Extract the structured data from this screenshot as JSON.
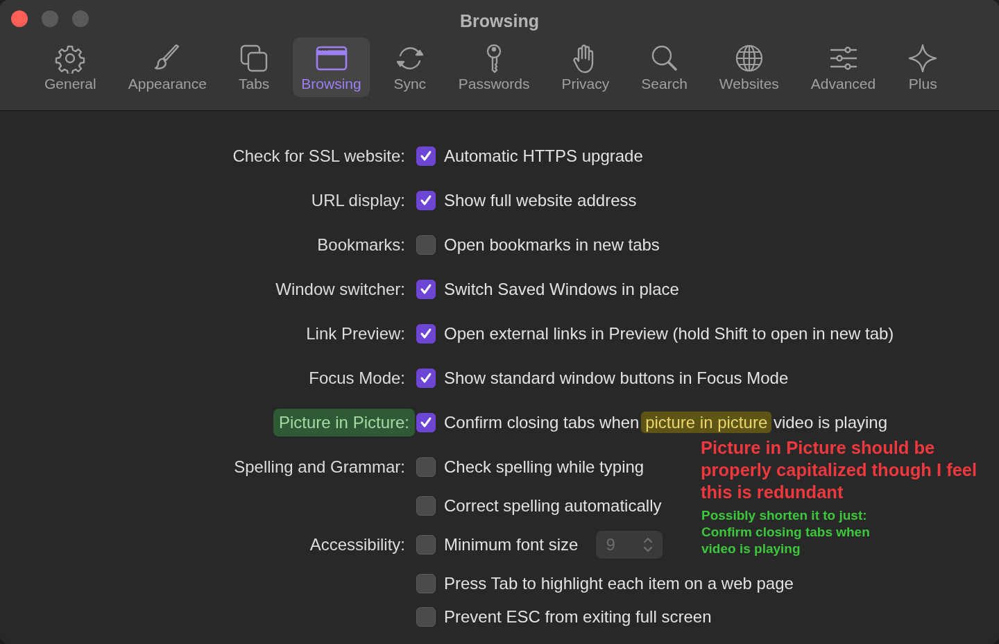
{
  "window": {
    "title": "Browsing"
  },
  "tabs": [
    {
      "label": "General",
      "selected": false
    },
    {
      "label": "Appearance",
      "selected": false
    },
    {
      "label": "Tabs",
      "selected": false
    },
    {
      "label": "Browsing",
      "selected": true
    },
    {
      "label": "Sync",
      "selected": false
    },
    {
      "label": "Passwords",
      "selected": false
    },
    {
      "label": "Privacy",
      "selected": false
    },
    {
      "label": "Search",
      "selected": false
    },
    {
      "label": "Websites",
      "selected": false
    },
    {
      "label": "Advanced",
      "selected": false
    },
    {
      "label": "Plus",
      "selected": false
    }
  ],
  "settings": [
    {
      "label": "Check for SSL website:",
      "options": [
        {
          "parts": [
            {
              "text": "Automatic HTTPS upgrade"
            }
          ],
          "checked": true
        }
      ]
    },
    {
      "label": "URL display:",
      "options": [
        {
          "parts": [
            {
              "text": "Show full website address"
            }
          ],
          "checked": true
        }
      ]
    },
    {
      "label": "Bookmarks:",
      "options": [
        {
          "parts": [
            {
              "text": "Open bookmarks in new tabs"
            }
          ],
          "checked": false
        }
      ]
    },
    {
      "label": "Window switcher:",
      "options": [
        {
          "parts": [
            {
              "text": "Switch Saved Windows in place"
            }
          ],
          "checked": true
        }
      ]
    },
    {
      "label": "Link Preview:",
      "options": [
        {
          "parts": [
            {
              "text": "Open external links in Preview (hold Shift to open in new tab)"
            }
          ],
          "checked": true
        }
      ]
    },
    {
      "label": "Focus Mode:",
      "options": [
        {
          "parts": [
            {
              "text": "Show standard window buttons in Focus Mode"
            }
          ],
          "checked": true
        }
      ]
    },
    {
      "label": "Picture in Picture:",
      "label_highlighted": true,
      "options": [
        {
          "parts": [
            {
              "text": "Confirm closing tabs when"
            },
            {
              "text": "picture in picture",
              "highlighted": true
            },
            {
              "text": "video is playing"
            }
          ],
          "checked": true
        }
      ]
    },
    {
      "label": "Spelling and Grammar:",
      "options": [
        {
          "parts": [
            {
              "text": "Check spelling while typing"
            }
          ],
          "checked": false
        },
        {
          "parts": [
            {
              "text": "Correct spelling automatically"
            }
          ],
          "checked": false
        }
      ]
    },
    {
      "label": "Accessibility:",
      "options": [
        {
          "parts": [
            {
              "text": "Minimum font size"
            }
          ],
          "checked": false,
          "stepper": {
            "value": "9",
            "disabled": true
          }
        },
        {
          "parts": [
            {
              "text": "Press Tab to highlight each item on a web page"
            }
          ],
          "checked": false
        },
        {
          "parts": [
            {
              "text": "Prevent ESC from exiting full screen"
            }
          ],
          "checked": false
        }
      ]
    }
  ],
  "annotations": [
    {
      "text": "Picture in Picture should be properly capitalized though I feel this is redundant",
      "color": "#f0383f",
      "kind": "large"
    },
    {
      "text": "Possibly shorten it to just: Confirm closing tabs when video is playing",
      "color": "#3cc73c",
      "kind": "small"
    }
  ]
}
